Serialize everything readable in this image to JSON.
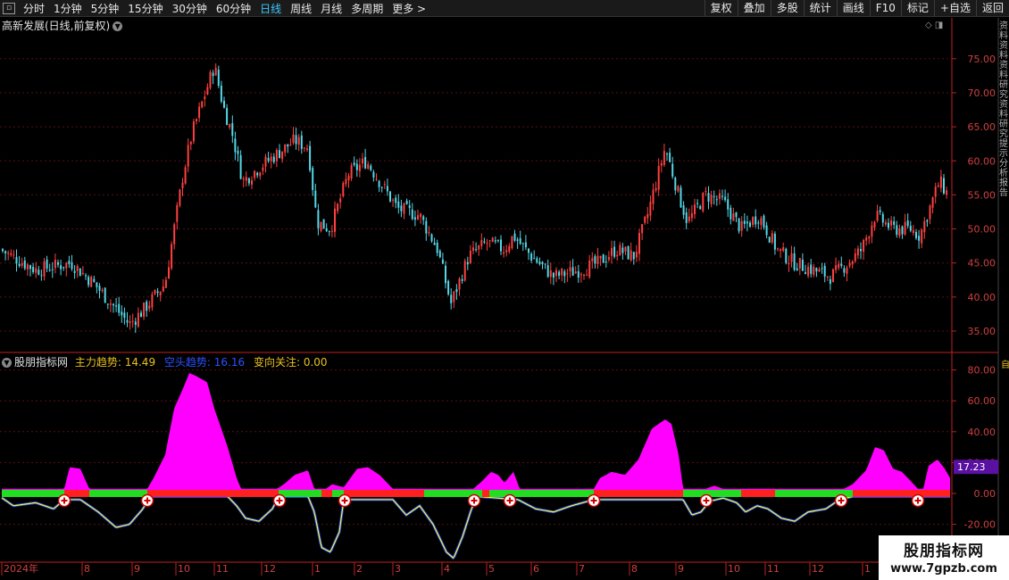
{
  "toolbar": {
    "periods": [
      "分时",
      "1分钟",
      "5分钟",
      "15分钟",
      "30分钟",
      "60分钟",
      "日线",
      "周线",
      "月线",
      "多周期",
      "更多 >"
    ],
    "active_period": "日线",
    "right_buttons": [
      "复权",
      "叠加",
      "多股",
      "统计",
      "画线",
      "F10",
      "标记",
      "+自选",
      "返回"
    ]
  },
  "price_panel": {
    "title": "高新发展(日线,前复权)",
    "axis_ticks": [
      "75.00",
      "70.00",
      "65.00",
      "60.00",
      "55.00",
      "50.00",
      "45.00",
      "40.00",
      "35.00"
    ]
  },
  "indicator_panel": {
    "name": "股朋指标网",
    "main_label": "主力趋势:",
    "main_value": "14.49",
    "bear_label": "空头趋势:",
    "bear_value": "16.16",
    "change_label": "变向关注:",
    "change_value": "0.00",
    "axis_ticks": [
      "80.00",
      "60.00",
      "40.00",
      "20.00",
      "0.00",
      "-20.00"
    ],
    "current_tag": "17.23"
  },
  "date_axis": [
    "2024年",
    "8",
    "9",
    "10",
    "11",
    "12",
    "1",
    "2",
    "3",
    "4",
    "5",
    "6",
    "7",
    "8",
    "9",
    "10",
    "11",
    "12",
    "1"
  ],
  "side_text": "资料资料资料研究资料研究提示分析报告",
  "side_yellow": "自",
  "watermark": {
    "line1": "股朋指标网",
    "line2": "www.7gpzb.com"
  },
  "colors": {
    "up": "#ff4040",
    "down": "#54d8e8",
    "magenta": "#ff00ff",
    "green_bar": "#22dd22",
    "red_bar": "#ff2020",
    "yellow_line": "#ffff00",
    "blue_line": "#2040ff",
    "axis_red": "#c02020"
  }
}
